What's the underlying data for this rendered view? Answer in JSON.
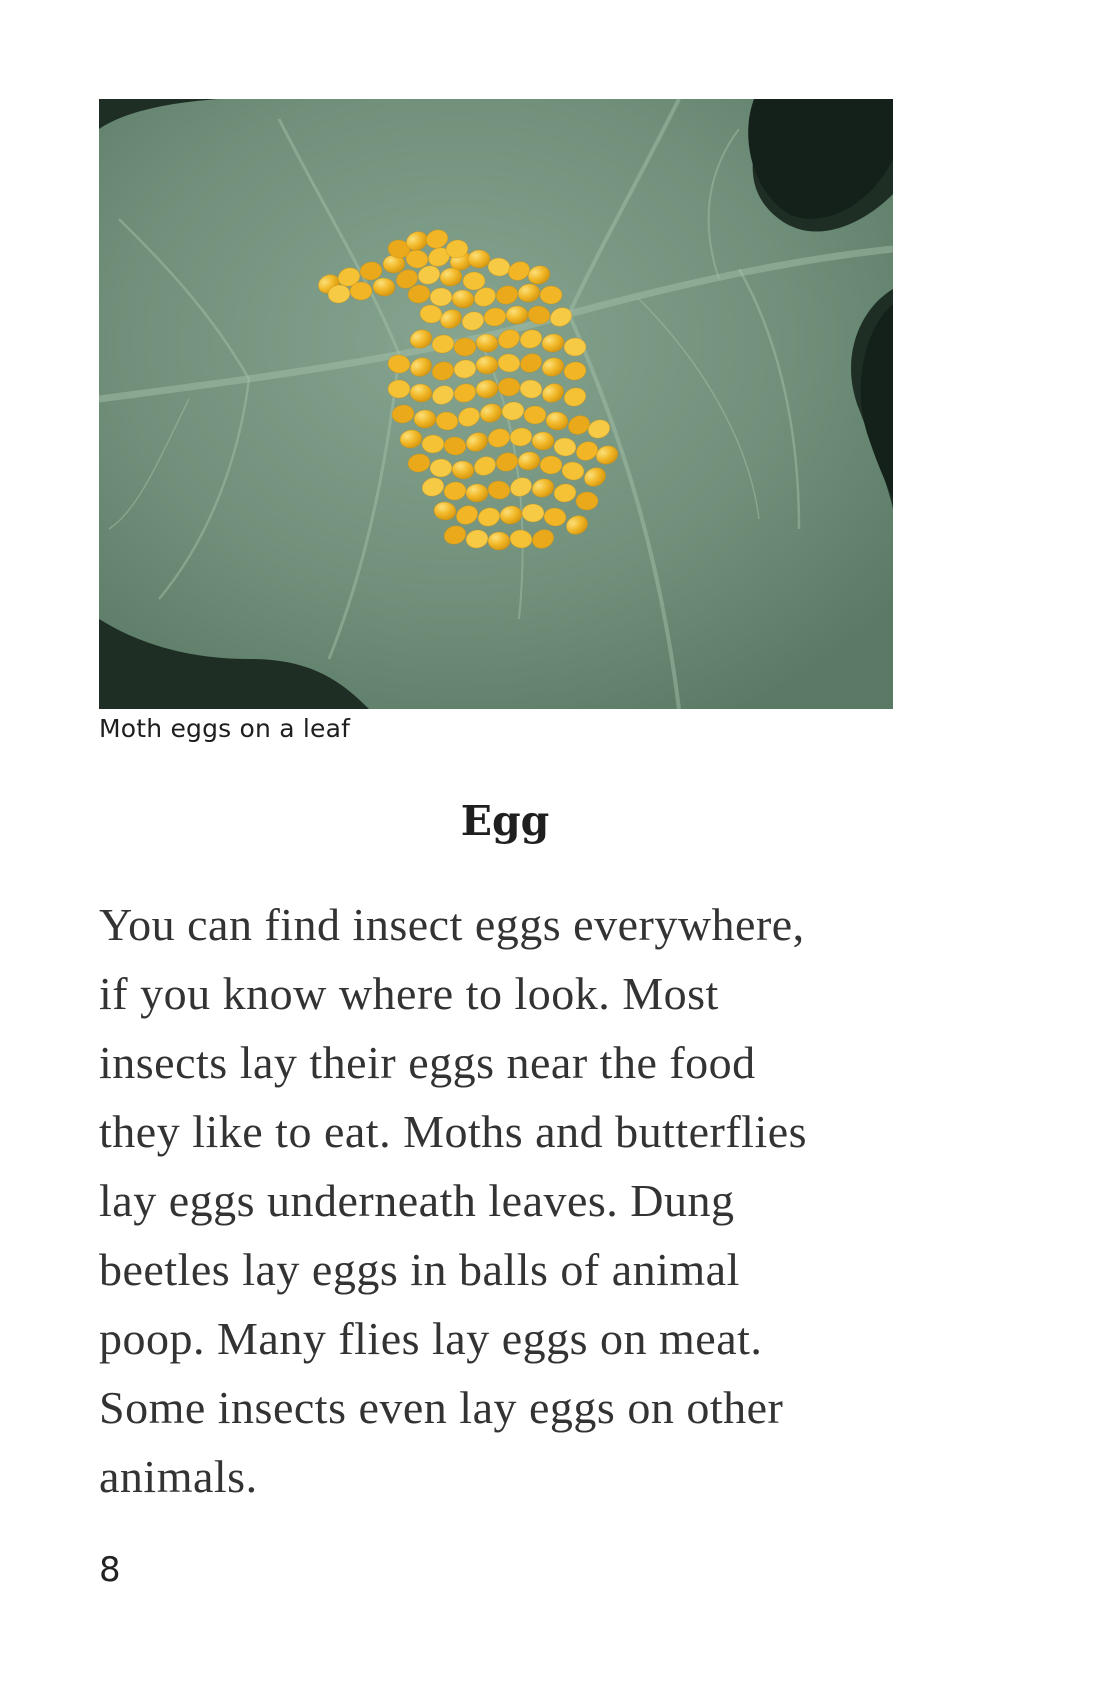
{
  "figure": {
    "caption": "Moth eggs on a leaf",
    "colors": {
      "leaf": "#6f8d78",
      "leaf_light": "#82a08a",
      "dark_background": "#1d2b22",
      "egg": "#f1b526"
    }
  },
  "section": {
    "heading": "Egg",
    "lines": [
      "You can find insect eggs everywhere,",
      "if you know where to look. Most",
      "insects lay their eggs near the food",
      "they like to eat. Moths and butterflies",
      "lay eggs underneath leaves. Dung",
      "beetles lay eggs in balls of animal",
      "poop. Many flies lay eggs on meat.",
      "Some insects even lay eggs on other",
      "animals."
    ]
  },
  "page_number": "8"
}
